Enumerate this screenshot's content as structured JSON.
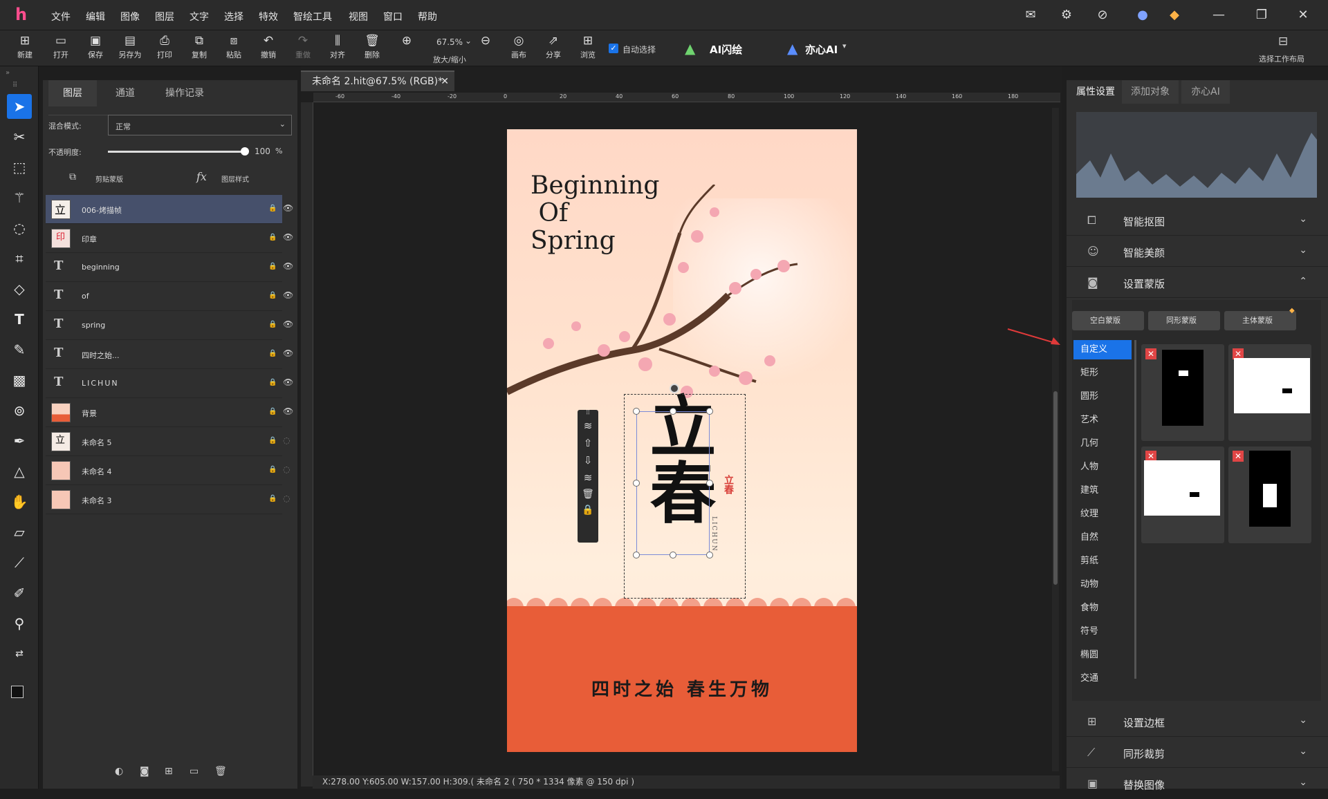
{
  "menubar": {
    "items": [
      "文件",
      "编辑",
      "图像",
      "图层",
      "文字",
      "选择",
      "特效",
      "智绘工具",
      "视图",
      "窗口",
      "帮助"
    ]
  },
  "toolbar": {
    "items": [
      "新建",
      "打开",
      "保存",
      "另存为",
      "打印",
      "复制",
      "粘贴",
      "撤销",
      "重做",
      "对齐",
      "删除"
    ],
    "zoom_value": "67.5%",
    "zoom_label": "放大/缩小",
    "more": [
      "画布",
      "分享",
      "浏览"
    ],
    "auto_select": "自动选择",
    "ai_flash": "AI闪绘",
    "yixin_ai": "亦心AI",
    "workspace": "选择工作布局"
  },
  "layers": {
    "tabs": [
      "图层",
      "通道",
      "操作记录"
    ],
    "blend_label": "混合模式:",
    "blend_value": "正常",
    "opacity_label": "不透明度:",
    "opacity_value": "100",
    "opacity_unit": "%",
    "opacity_fraction": 1.0,
    "clip_mask": "剪贴蒙版",
    "layer_style": "图层样式",
    "items": [
      "006-烤描帧",
      "印章",
      "beginning",
      "of",
      "spring",
      "四时之始...",
      "LICHUN",
      "背景",
      "未命名 5",
      "未命名 4",
      "未命名 3"
    ]
  },
  "document": {
    "tab": "未命名 2.hit@67.5% (RGB)*",
    "ruler_ticks": [
      "-60",
      "-40",
      "-20",
      "0",
      "20",
      "40",
      "60",
      "80",
      "100",
      "120",
      "140",
      "160",
      "180"
    ],
    "poster_title": "Beginning\n Of\nSpring",
    "slogan": "四时之始 春生万物",
    "seal": "立春",
    "vertical_text": "LICHUN",
    "calligraphy": "立春"
  },
  "status": "X:278.00 Y:605.00 W:157.00 H:309.(     未命名 2 ( 750 * 1334 像素 @ 150 dpi )",
  "right": {
    "tabs": [
      "属性设置",
      "添加对象",
      "亦心AI"
    ],
    "sections_top": [
      "智能抠图",
      "智能美颜",
      "设置蒙版"
    ],
    "mask_buttons": [
      "空白蒙版",
      "同形蒙版",
      "主体蒙版"
    ],
    "categories": [
      "自定义",
      "矩形",
      "圆形",
      "艺术",
      "几何",
      "人物",
      "建筑",
      "纹理",
      "自然",
      "剪纸",
      "动物",
      "食物",
      "符号",
      "椭圆",
      "交通"
    ],
    "sections_bottom": [
      "设置边框",
      "同形裁剪",
      "替换图像"
    ]
  },
  "colors": {
    "accent": "#1a73e8",
    "wall": "#e85d38",
    "selected_layer": "#46506b"
  }
}
